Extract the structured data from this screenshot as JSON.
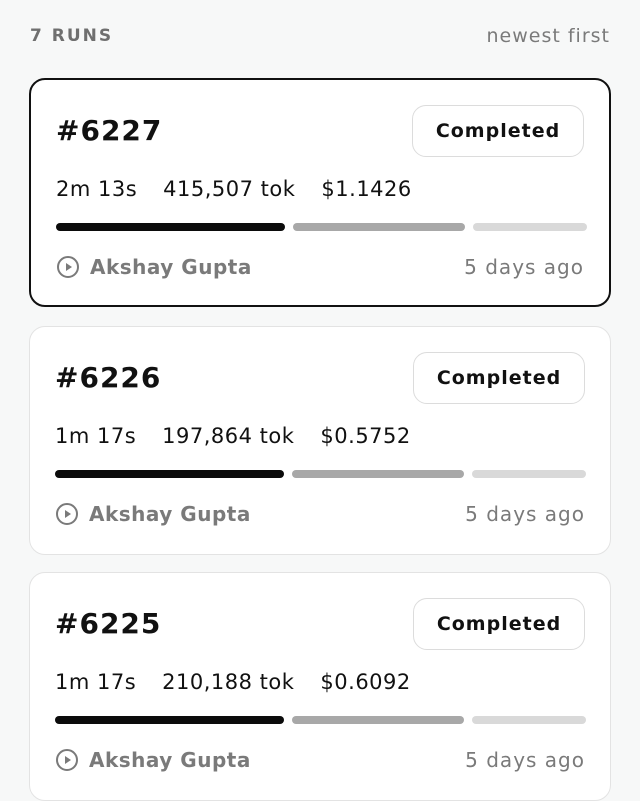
{
  "header": {
    "count_label": "7 RUNS",
    "sort_label": "newest first"
  },
  "runs": [
    {
      "id": "#6227",
      "status": "Completed",
      "duration": "2m 13s",
      "tokens": "415,507 tok",
      "cost": "$1.1426",
      "author": "Akshay Gupta",
      "time": "5 days ago"
    },
    {
      "id": "#6226",
      "status": "Completed",
      "duration": "1m 17s",
      "tokens": "197,864 tok",
      "cost": "$0.5752",
      "author": "Akshay Gupta",
      "time": "5 days ago"
    },
    {
      "id": "#6225",
      "status": "Completed",
      "duration": "1m 17s",
      "tokens": "210,188 tok",
      "cost": "$0.6092",
      "author": "Akshay Gupta",
      "time": "5 days ago"
    }
  ],
  "icons": {
    "author": "play-circle-icon"
  },
  "colors": {
    "selected_border": "#111111",
    "bar_dark": "#0b0b0b",
    "bar_mid": "#a8a8a8",
    "bar_light": "#d9d9d9"
  }
}
